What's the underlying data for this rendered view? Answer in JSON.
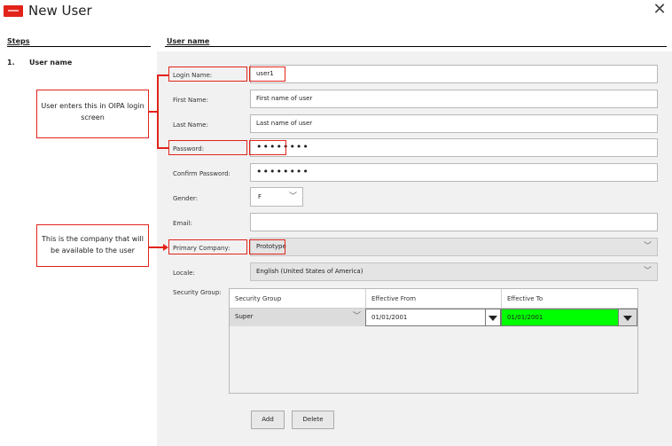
{
  "window": {
    "title": "New User"
  },
  "steps": {
    "heading": "Steps",
    "items": [
      {
        "num": "1.",
        "label": "User name"
      }
    ]
  },
  "main": {
    "heading": "User name",
    "fields": {
      "login_label": "Login Name:",
      "login_value": "user1",
      "first_label": "First Name:",
      "first_value": "First name of user",
      "last_label": "Last Name:",
      "last_value": "Last name of user",
      "password_label": "Password:",
      "password_value": "••••••••",
      "confirm_label": "Confirm Password:",
      "confirm_value": "••••••••",
      "gender_label": "Gender:",
      "gender_value": "F",
      "email_label": "Email:",
      "email_value": "",
      "company_label": "Primary Company:",
      "company_value": "Prototype",
      "locale_label": "Locale:",
      "locale_value": "English (United States of America)",
      "security_label": "Security Group:"
    },
    "security_grid": {
      "headers": [
        "Security Group",
        "Effective From",
        "Effective To"
      ],
      "rows": [
        {
          "group": "Super",
          "from": "01/01/2001",
          "to": "01/01/2001"
        }
      ]
    },
    "buttons": {
      "add": "Add",
      "delete": "Delete"
    }
  },
  "callouts": {
    "login": "User enters this in OIPA login screen",
    "company": "This is the company that will be available to the user"
  },
  "colors": {
    "accent": "#e2231a",
    "highlight_green": "#00ff00"
  }
}
